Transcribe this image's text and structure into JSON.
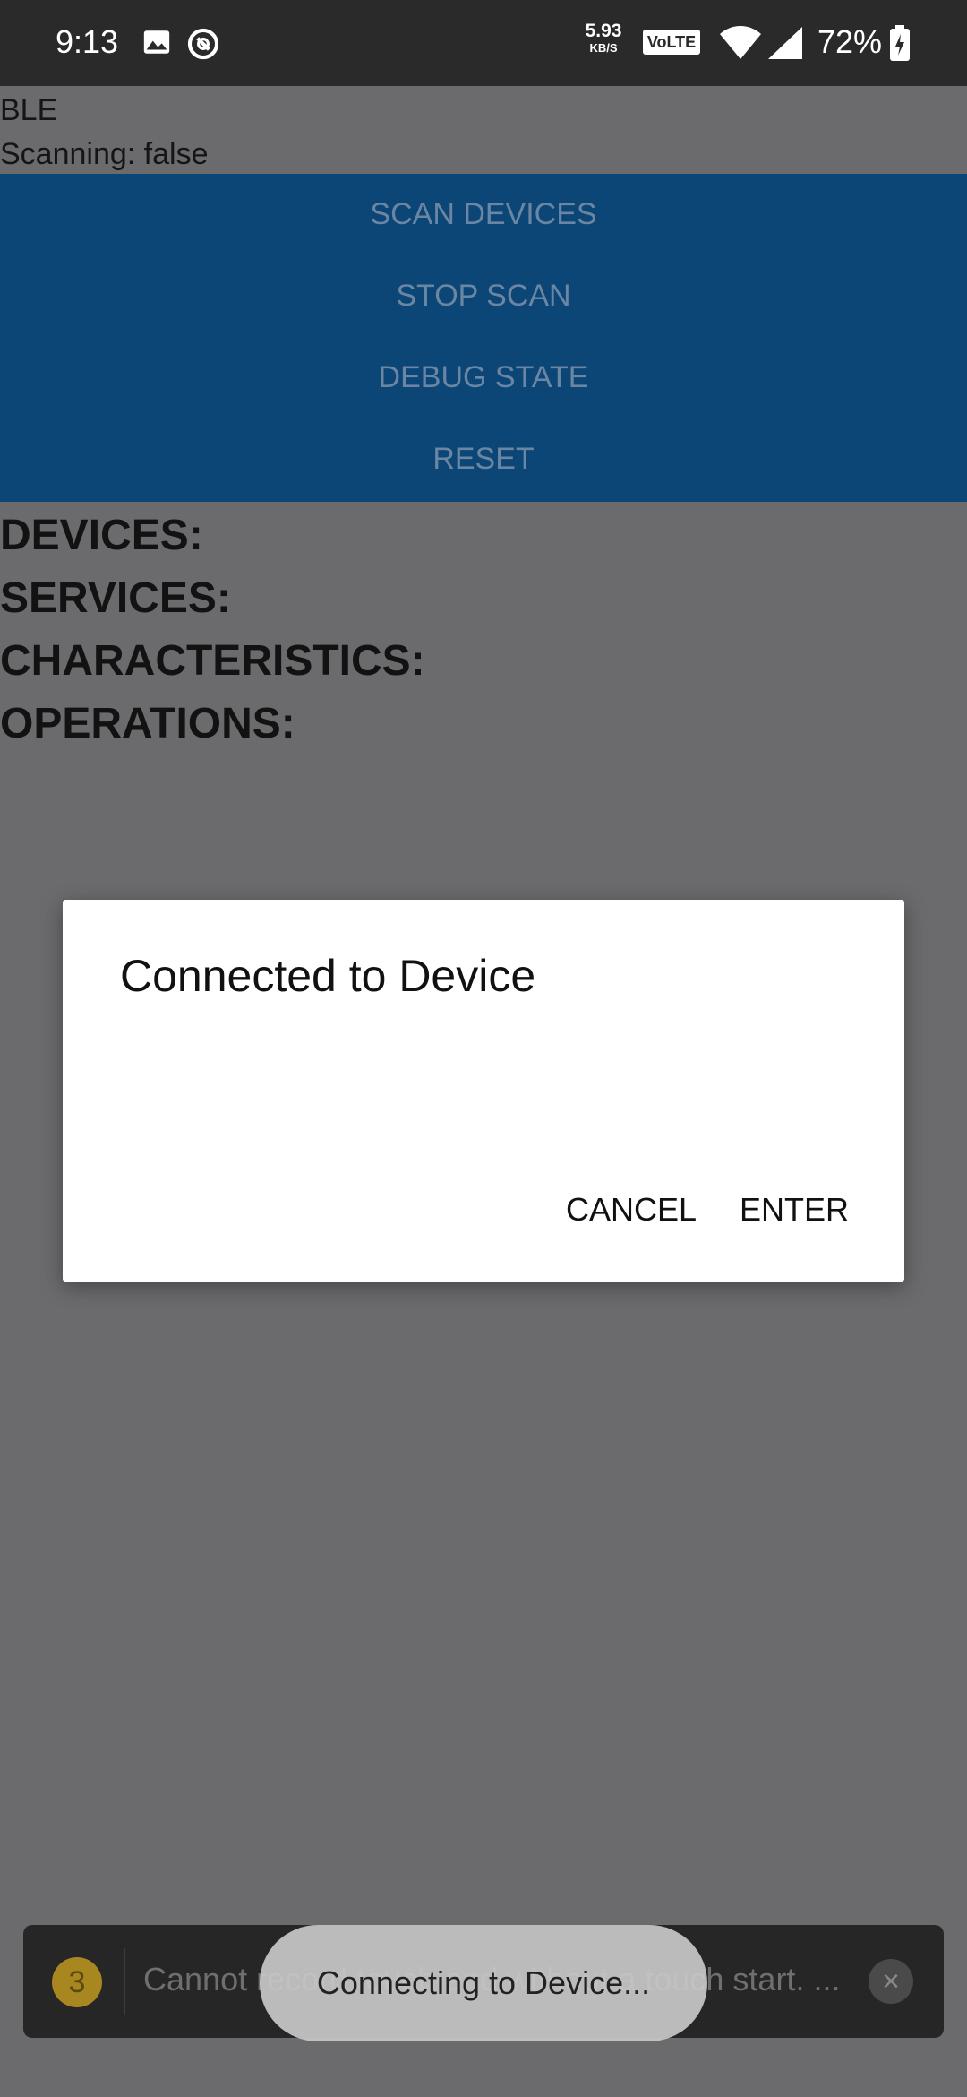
{
  "status_bar": {
    "time": "9:13",
    "network_speed_value": "5.93",
    "network_speed_unit": "KB/S",
    "volte_label": "VoLTE",
    "battery_percent": "72%",
    "icons": [
      "image-icon",
      "do-not-disturb-icon",
      "wifi-icon",
      "cell-signal-icon",
      "battery-charging-icon"
    ]
  },
  "app": {
    "title": "BLE",
    "scanning_status": "Scanning: false",
    "buttons": [
      {
        "label": "SCAN DEVICES"
      },
      {
        "label": "STOP SCAN"
      },
      {
        "label": "DEBUG STATE"
      },
      {
        "label": "RESET"
      }
    ],
    "sections": [
      {
        "label": "DEVICES:"
      },
      {
        "label": "SERVICES:"
      },
      {
        "label": "CHARACTERISTICS:"
      },
      {
        "label": "OPERATIONS:"
      }
    ],
    "button_block_color": "#0b4677"
  },
  "dialog": {
    "title": "Connected to Device",
    "cancel_label": "CANCEL",
    "enter_label": "ENTER"
  },
  "warning_banner": {
    "count": "3",
    "message": "Cannot record touch end without a touch start. ...",
    "close_icon": "close-icon"
  },
  "toast": {
    "message": "Connecting to Device..."
  }
}
